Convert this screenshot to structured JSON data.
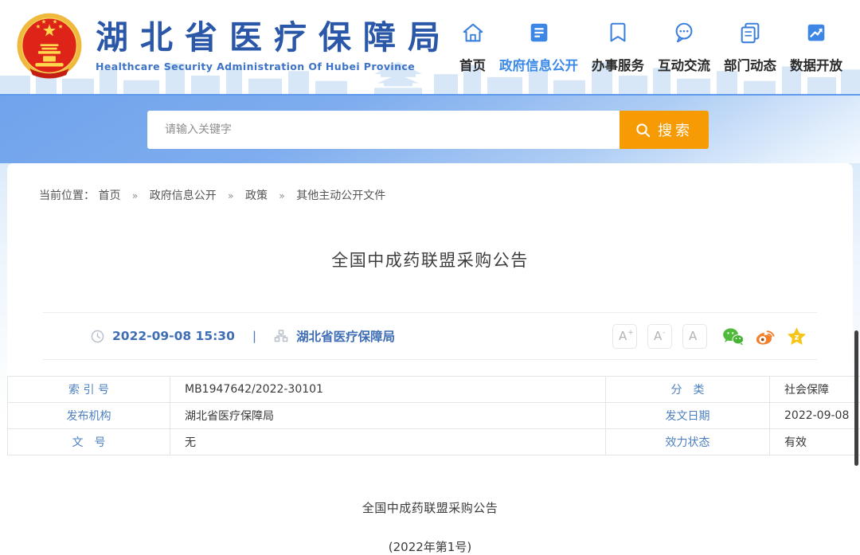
{
  "header": {
    "site_title": "湖北省医疗保障局",
    "site_subtitle": "Healthcare Security Administration Of Hubei Province",
    "logo_icon": "national-emblem-icon",
    "nav_items": [
      {
        "label": "首页",
        "icon": "home-icon",
        "active": false
      },
      {
        "label": "政府信息公开",
        "icon": "document-icon",
        "active": true
      },
      {
        "label": "办事服务",
        "icon": "bookmark-icon",
        "active": false
      },
      {
        "label": "互动交流",
        "icon": "chat-bubble-icon",
        "active": false
      },
      {
        "label": "部门动态",
        "icon": "copy-pages-icon",
        "active": false
      },
      {
        "label": "数据开放",
        "icon": "trend-chart-icon",
        "active": false
      }
    ]
  },
  "search": {
    "placeholder": "请输入关键字",
    "button_label": "搜索",
    "button_icon": "search-icon",
    "button_color": "#f79b04"
  },
  "breadcrumb": {
    "prefix": "当前位置：",
    "separator": "»",
    "items": [
      "首页",
      "政府信息公开",
      "政策",
      "其他主动公开文件"
    ]
  },
  "article": {
    "title": "全国中成药联盟采购公告",
    "publish_time": "2022-09-08 15:30",
    "meta_separator": "|",
    "source": "湖北省医疗保障局",
    "time_icon": "clock-icon",
    "source_icon": "organization-icon",
    "font_size_buttons": [
      {
        "base": "A",
        "sup": "+"
      },
      {
        "base": "A",
        "sup": "-"
      },
      {
        "base": "A",
        "sup": ""
      }
    ],
    "share_icons": [
      "wechat-icon",
      "weibo-icon",
      "qzone-star-icon"
    ],
    "body_line1": "全国中成药联盟采购公告",
    "body_line2": "(2022年第1号)"
  },
  "info_table": {
    "row1": {
      "label1": "索 引 号",
      "value1": "MB1947642/2022-30101",
      "label2": "分　类",
      "value2": "社会保障"
    },
    "row2": {
      "label1": "发布机构",
      "value1": "湖北省医疗保障局",
      "label2": "发文日期",
      "value2": "2022-09-08"
    },
    "row3": {
      "label1": "文　号",
      "value1": "无",
      "label2": "效力状态",
      "value2": "有效"
    }
  },
  "colors": {
    "brand_blue": "#2a57a7",
    "nav_active_blue": "#3c8ae8",
    "banner_blue": "#6fa3ec",
    "accent_orange": "#f79b04",
    "link_blue": "#3f6eb5",
    "table_label_blue": "#4d80bf",
    "wechat_green": "#4fbb3a",
    "weibo_orange": "#f2802b",
    "qzone_yellow": "#f5c518"
  }
}
